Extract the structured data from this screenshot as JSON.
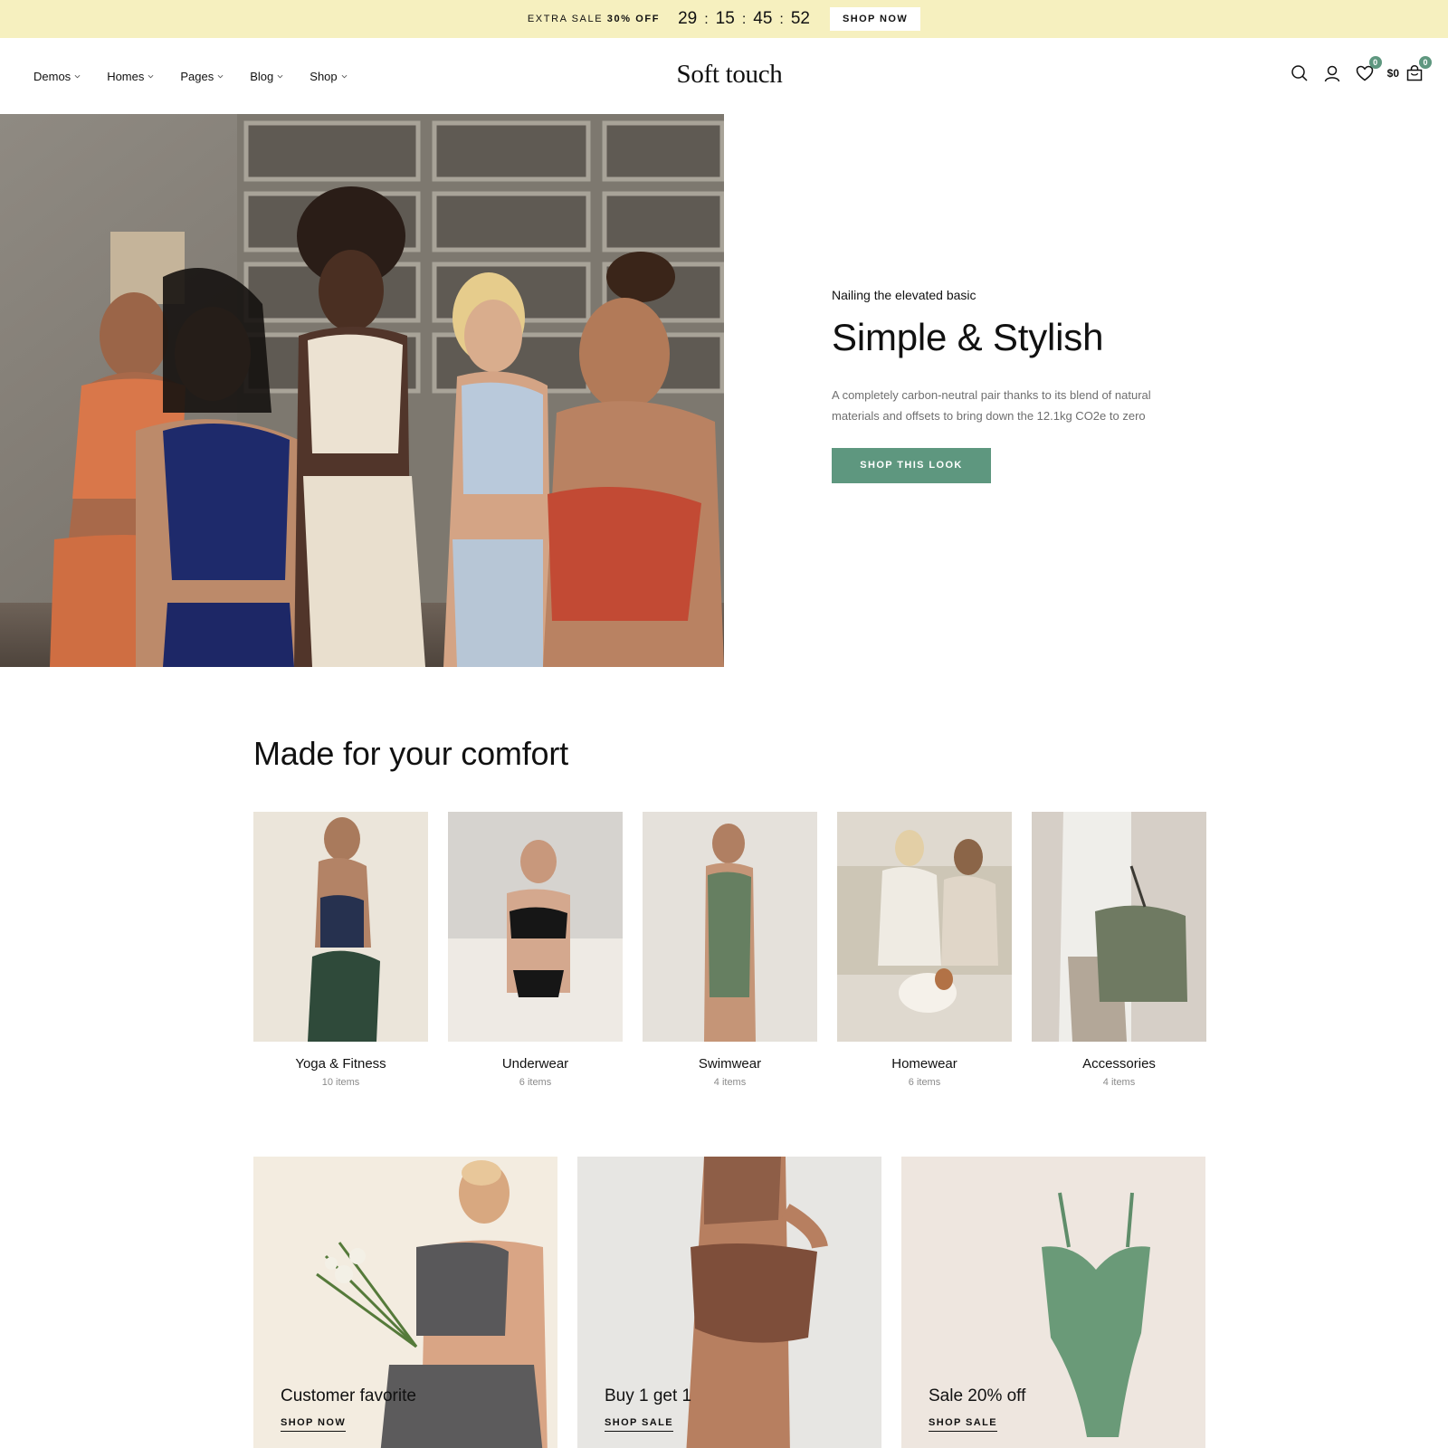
{
  "promo": {
    "label": "EXTRA SALE",
    "highlight": "30% OFF",
    "countdown": [
      "29",
      "15",
      "45",
      "52"
    ],
    "button": "SHOP NOW"
  },
  "nav": {
    "items": [
      {
        "label": "Demos"
      },
      {
        "label": "Homes"
      },
      {
        "label": "Pages"
      },
      {
        "label": "Blog"
      },
      {
        "label": "Shop"
      }
    ]
  },
  "brand": {
    "name": "Soft touch"
  },
  "header_icons": {
    "wishlist_count": "0",
    "cart_total": "$0",
    "cart_count": "0"
  },
  "hero": {
    "kicker": "Nailing the elevated basic",
    "title": "Simple & Stylish",
    "description": "A completely carbon-neutral pair thanks to its blend of natural materials and offsets to bring down the 12.1kg CO2e to zero",
    "button": "SHOP THIS LOOK"
  },
  "section": {
    "title": "Made for your comfort"
  },
  "categories": [
    {
      "name": "Yoga & Fitness",
      "count": "10 items"
    },
    {
      "name": "Underwear",
      "count": "6 items"
    },
    {
      "name": "Swimwear",
      "count": "4 items"
    },
    {
      "name": "Homewear",
      "count": "6 items"
    },
    {
      "name": "Accessories",
      "count": "4 items"
    }
  ],
  "cards": [
    {
      "title": "Customer favorite",
      "link": "SHOP NOW"
    },
    {
      "title": "Buy 1 get 1",
      "link": "SHOP SALE"
    },
    {
      "title": "Sale 20% off",
      "link": "SHOP SALE"
    }
  ],
  "colors": {
    "promo_bg": "#f6f0bf",
    "accent": "#5e977f"
  }
}
